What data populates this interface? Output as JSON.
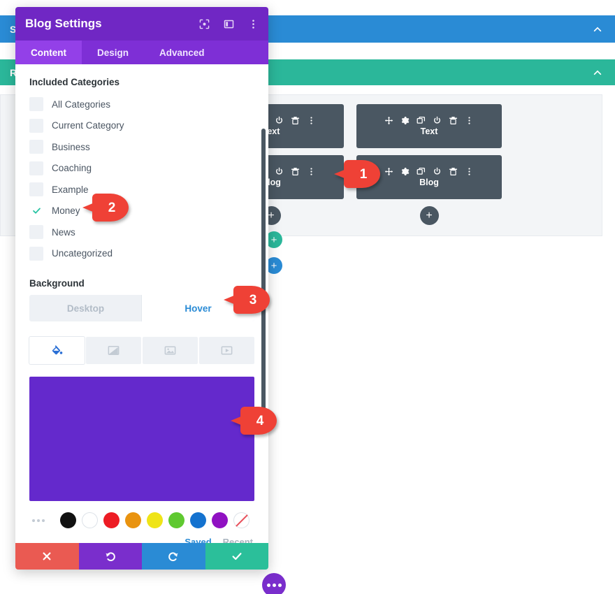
{
  "builder": {
    "section_bar": {
      "label": "Section",
      "color": "#2a8bd5",
      "collapse_icon": "chevron-up-icon"
    },
    "row_bar": {
      "label": "Row",
      "color": "#2bb79a",
      "collapse_icon": "chevron-up-icon"
    },
    "module_toolbar_icons": [
      "move-icon",
      "gear-icon",
      "duplicate-icon",
      "power-icon",
      "trash-icon",
      "kebab-menu-icon"
    ],
    "columns": [
      {
        "modules": [
          {
            "name": "Text"
          },
          {
            "name": "Blog"
          }
        ],
        "add_label": "+"
      },
      {
        "modules": [
          {
            "name": "Text"
          },
          {
            "name": "Blog"
          }
        ],
        "add_label": "+"
      }
    ],
    "add_row_button": {
      "label": "+",
      "color": "#2bb79a"
    },
    "add_section_button": {
      "label": "+",
      "color": "#2a8bd5"
    },
    "fab_more": {
      "icon": "ellipsis-icon",
      "color": "#7a2ecc"
    }
  },
  "modal": {
    "title": "Blog Settings",
    "header_icons": [
      "focus-mode-icon",
      "panel-layout-icon",
      "kebab-menu-icon"
    ],
    "tabs": [
      {
        "label": "Content",
        "active": true
      },
      {
        "label": "Design",
        "active": false
      },
      {
        "label": "Advanced",
        "active": false
      }
    ],
    "categories": {
      "label": "Included Categories",
      "items": [
        {
          "name": "All Categories",
          "checked": false
        },
        {
          "name": "Current Category",
          "checked": false
        },
        {
          "name": "Business",
          "checked": false
        },
        {
          "name": "Coaching",
          "checked": false
        },
        {
          "name": "Example",
          "checked": false
        },
        {
          "name": "Money",
          "checked": true
        },
        {
          "name": "News",
          "checked": false
        },
        {
          "name": "Uncategorized",
          "checked": false
        }
      ]
    },
    "background": {
      "label": "Background",
      "state_tabs": [
        {
          "label": "Desktop",
          "active": false
        },
        {
          "label": "Hover",
          "active": true
        }
      ],
      "types": [
        {
          "icon": "paint-bucket-icon",
          "active": true
        },
        {
          "icon": "gradient-icon",
          "active": false
        },
        {
          "icon": "image-icon",
          "active": false
        },
        {
          "icon": "video-icon",
          "active": false
        }
      ],
      "selected_color": "#6429cc",
      "swatches": [
        {
          "name": "black",
          "color": "#111111"
        },
        {
          "name": "white",
          "color": "#ffffff"
        },
        {
          "name": "red",
          "color": "#ed1c24"
        },
        {
          "name": "orange",
          "color": "#e9930f"
        },
        {
          "name": "yellow",
          "color": "#efe417"
        },
        {
          "name": "green",
          "color": "#5fc930"
        },
        {
          "name": "blue",
          "color": "#1472cf"
        },
        {
          "name": "purple",
          "color": "#9011c2"
        },
        {
          "name": "none",
          "color": "transparent"
        }
      ],
      "more_swatches_icon": "ellipsis-icon",
      "palette_tabs": [
        {
          "label": "Saved",
          "active": true
        },
        {
          "label": "Recent",
          "active": false
        }
      ]
    },
    "footer_buttons": [
      {
        "name": "discard",
        "icon": "close-icon",
        "color": "#ea5a52"
      },
      {
        "name": "undo",
        "icon": "undo-icon",
        "color": "#7a2ecc"
      },
      {
        "name": "redo",
        "icon": "redo-icon",
        "color": "#2a8bd5"
      },
      {
        "name": "save",
        "icon": "check-icon",
        "color": "#2bbf9a"
      }
    ]
  },
  "callouts": [
    {
      "number": "1"
    },
    {
      "number": "2"
    },
    {
      "number": "3"
    },
    {
      "number": "4"
    }
  ]
}
